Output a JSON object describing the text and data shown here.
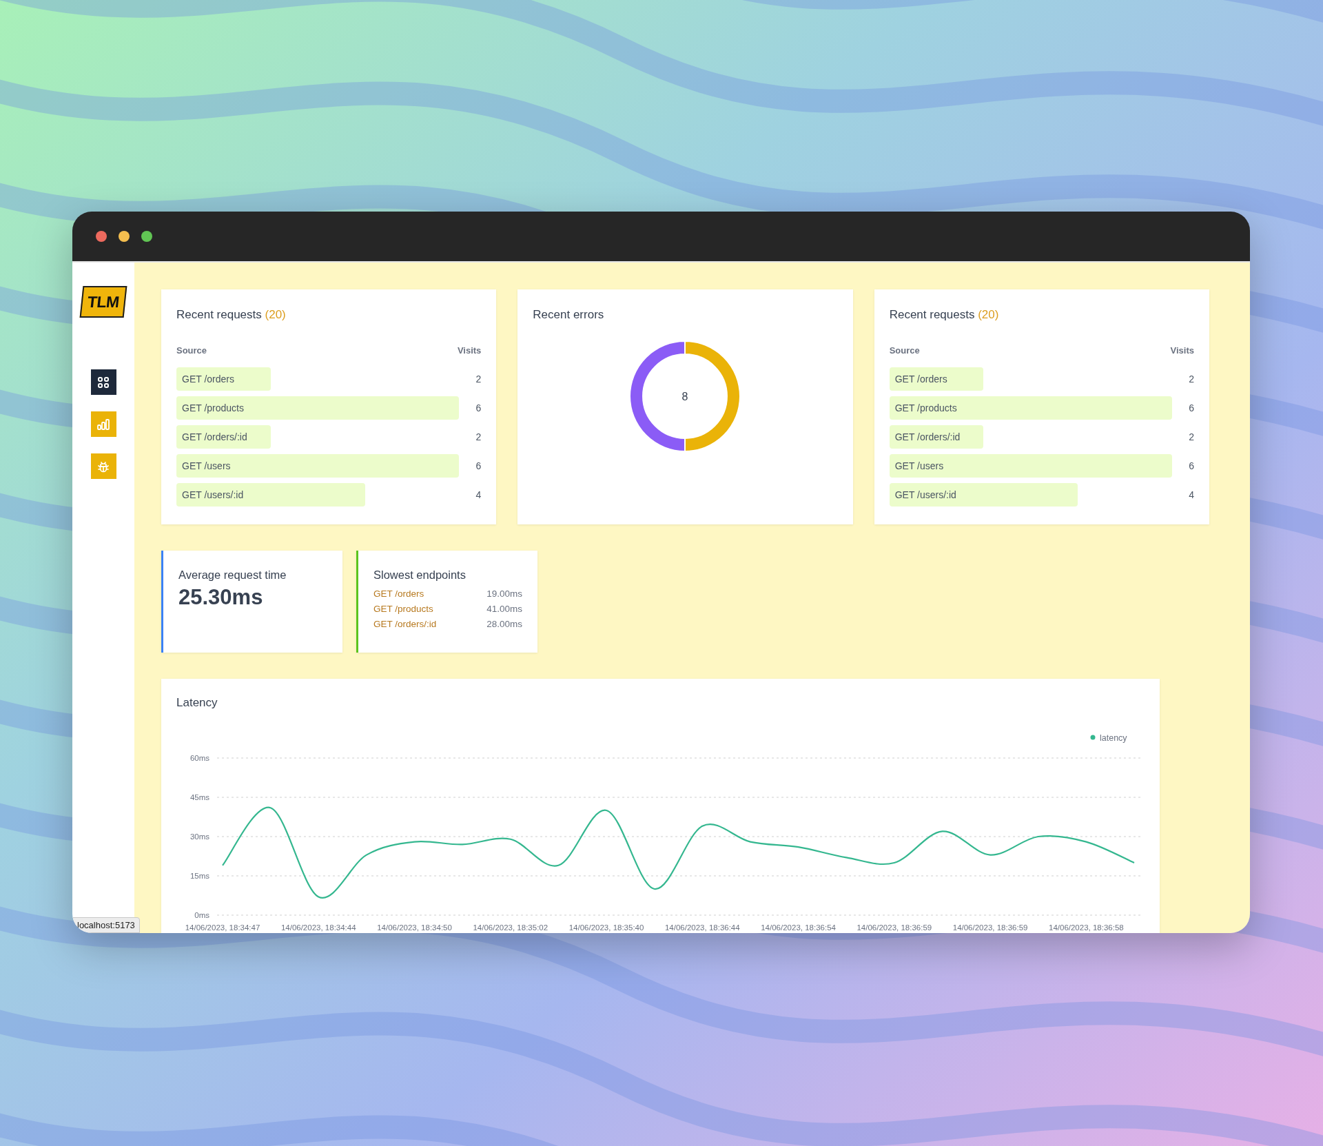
{
  "window": {
    "controls": [
      {
        "kind": "close"
      },
      {
        "kind": "minimize"
      },
      {
        "kind": "zoom"
      }
    ]
  },
  "sidebar": {
    "logo": "TLM",
    "items": [
      {
        "kind": "grid",
        "selected": true
      },
      {
        "kind": "chart",
        "selected": false
      },
      {
        "kind": "bug",
        "selected": false
      }
    ]
  },
  "cards": [
    {
      "kind": "table",
      "title": "Recent requests",
      "count": "(20)",
      "columns": [
        "Source",
        "Visits"
      ],
      "rows": [
        {
          "source": "GET /orders",
          "visits": "2"
        },
        {
          "source": "GET /products",
          "visits": "6"
        },
        {
          "source": "GET /orders/:id",
          "visits": "2"
        },
        {
          "source": "GET /users",
          "visits": "6"
        },
        {
          "source": "GET /users/:id",
          "visits": "4"
        }
      ]
    },
    {
      "kind": "donut",
      "title": "Recent errors",
      "total": "8",
      "chart_data": {
        "type": "donut",
        "values": [
          50,
          50
        ]
      }
    },
    {
      "kind": "table",
      "title": "Recent requests",
      "count": "(20)",
      "columns": [
        "Source",
        "Visits"
      ],
      "rows": [
        {
          "source": "GET /orders",
          "visits": "2"
        },
        {
          "source": "GET /products",
          "visits": "6"
        },
        {
          "source": "GET /orders/:id",
          "visits": "2"
        },
        {
          "source": "GET /users",
          "visits": "6"
        },
        {
          "source": "GET /users/:id",
          "visits": "4"
        }
      ]
    }
  ],
  "stats": [
    {
      "kind": "value",
      "title": "Average request time",
      "value": "25.30ms",
      "color": "#3b82f6"
    },
    {
      "kind": "list",
      "title": "Slowest endpoints",
      "color": "#5cc41e",
      "rows": [
        {
          "endpoint": "GET /orders",
          "time": "19.00ms"
        },
        {
          "endpoint": "GET /products",
          "time": "41.00ms"
        },
        {
          "endpoint": "GET /orders/:id",
          "time": "28.00ms"
        }
      ]
    }
  ],
  "latency": {
    "title": "Latency",
    "chart_data": {
      "type": "line",
      "ylim": [
        0,
        60
      ],
      "grid": true,
      "categories": [
        "14/06/2023, 18:34:47",
        null,
        "14/06/2023, 18:34:44",
        null,
        "14/06/2023, 18:34:50",
        null,
        "14/06/2023, 18:35:02",
        null,
        "14/06/2023, 18:35:40",
        null,
        "14/06/2023, 18:36:44",
        null,
        "14/06/2023, 18:36:54",
        null,
        "14/06/2023, 18:36:59",
        null,
        "14/06/2023, 18:36:59",
        null,
        "14/06/2023, 18:36:58",
        null
      ],
      "yticks": [
        {
          "value": 0,
          "label": "0ms"
        },
        {
          "value": 15,
          "label": "15ms"
        },
        {
          "value": 30,
          "label": "30ms"
        },
        {
          "value": 45,
          "label": "45ms"
        },
        {
          "value": 60,
          "label": "60ms"
        }
      ],
      "series": [
        {
          "name": "latency",
          "color": "#34b78f",
          "values": [
            19,
            41,
            7,
            23,
            28,
            27,
            29,
            19,
            40,
            10,
            34,
            28,
            26,
            22,
            20,
            32,
            23,
            30,
            28,
            20
          ]
        }
      ]
    }
  },
  "status_tooltip": "localhost:5173"
}
